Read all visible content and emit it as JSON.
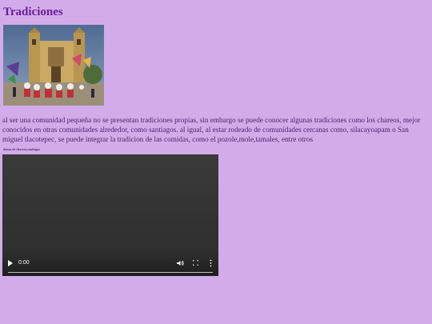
{
  "page": {
    "title": "Tradiciones",
    "paragraph": "al ser una comunidad pequeña no se presentan tradiciones propias, sin embargo se puede conocer algunas tradiciones como los chareos, mejor conocidos en otras comunidades alrededor, como santiagos. al igual, al estar rodeado de comunidades cercanas como, silacayoapam o San miguel tlacotepec, se puede integrar la tradicion de las comidas, como el pozole,mole,tamales, entre otros",
    "video_caption": "danza de chareos,santiagos"
  },
  "image": {
    "subject": "church-plaza-festival-dancers-photo"
  },
  "video": {
    "time": "0:00",
    "progress": 0,
    "controls": [
      "play-icon",
      "volume-icon",
      "fullscreen-icon",
      "more-options-icon"
    ]
  },
  "colors": {
    "background": "#d2acea",
    "title": "#6b1d98",
    "text": "#4a1f6a"
  }
}
